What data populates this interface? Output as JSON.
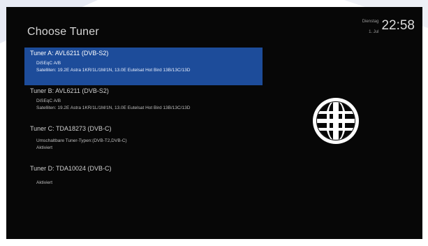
{
  "screen": {
    "title": "Choose Tuner",
    "datetime": {
      "weekday": "Dienstag",
      "day": "1. Jul",
      "time": "22:58"
    },
    "side_icon": "globe-icon",
    "tuners": [
      {
        "name": "Tuner A: AVL6211 (DVB-S2)",
        "selected": true,
        "details": [
          "DiSEqC A/B",
          "Satelliten: 19.2E Astra 1KR/1L/1M/1N, 13.0E Eutelsat Hot Bird 13B/13C/13D"
        ]
      },
      {
        "name": "Tuner B: AVL6211 (DVB-S2)",
        "selected": false,
        "details": [
          "DiSEqC A/B",
          "Satelliten: 19.2E Astra 1KR/1L/1M/1N, 13.0E Eutelsat Hot Bird 13B/13C/13D"
        ]
      },
      {
        "name": "Tuner C: TDA18273 (DVB-C)",
        "selected": false,
        "details": [
          "Umschaltbare Tuner-Typen:(DVB-T2,DVB-C)",
          "Aktiviert"
        ]
      },
      {
        "name": "Tuner D: TDA10024 (DVB-C)",
        "selected": false,
        "details": [
          "Aktiviert"
        ]
      }
    ]
  },
  "colors": {
    "background": "#070707",
    "selection": "#1d4c9a",
    "text": "#d8d8d8"
  }
}
